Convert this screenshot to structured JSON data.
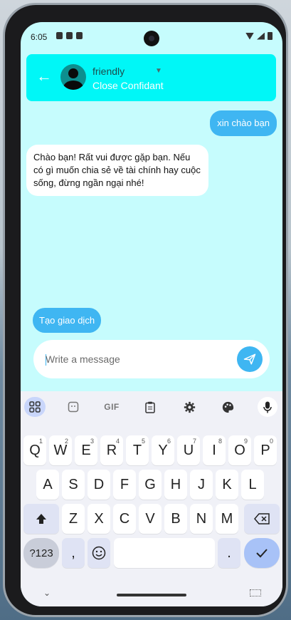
{
  "status_bar": {
    "time": "6:05"
  },
  "header": {
    "back_icon": "arrow-left-icon",
    "contact_name": "friendly",
    "relationship": "Close Confidant",
    "dropdown_icon": "chevron-down-icon"
  },
  "messages": [
    {
      "sender": "me",
      "text": "xin chào bạn"
    },
    {
      "sender": "bot",
      "text": "Chào bạn! Rất vui được gặp bạn. Nếu có gì muốn chia sẻ về tài chính hay cuộc sống, đừng ngần ngại nhé!"
    }
  ],
  "quick_action": {
    "label": "Tạo giao dịch"
  },
  "composer": {
    "placeholder": "Write a message",
    "value": ""
  },
  "keyboard": {
    "toolbar": [
      "apps-grid-icon",
      "sticker-icon",
      "GIF",
      "clipboard-icon",
      "settings-icon",
      "palette-icon",
      "mic-icon"
    ],
    "gif_label": "GIF",
    "row1": [
      {
        "k": "Q",
        "h": "1"
      },
      {
        "k": "W",
        "h": "2"
      },
      {
        "k": "E",
        "h": "3"
      },
      {
        "k": "R",
        "h": "4"
      },
      {
        "k": "T",
        "h": "5"
      },
      {
        "k": "Y",
        "h": "6"
      },
      {
        "k": "U",
        "h": "7"
      },
      {
        "k": "I",
        "h": "8"
      },
      {
        "k": "O",
        "h": "9"
      },
      {
        "k": "P",
        "h": "0"
      }
    ],
    "row2": [
      "A",
      "S",
      "D",
      "F",
      "G",
      "H",
      "J",
      "K",
      "L"
    ],
    "row3": [
      "Z",
      "X",
      "C",
      "V",
      "B",
      "N",
      "M"
    ],
    "symbols_label": "?123",
    "comma_label": ",",
    "period_label": ".",
    "accent": "#3fb6f2"
  }
}
